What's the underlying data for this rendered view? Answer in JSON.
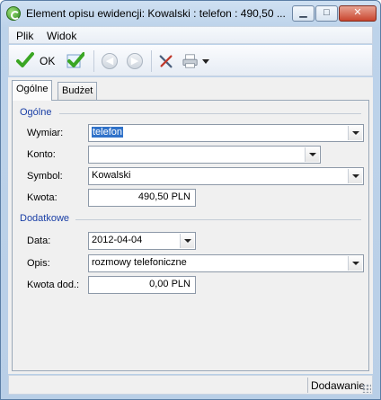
{
  "window": {
    "title": "Element opisu ewidencji: Kowalski : telefon : 490,50 ...",
    "min_symbol": "▁",
    "max_symbol": "□",
    "close_symbol": "✕"
  },
  "menu": [
    {
      "label": "Plik"
    },
    {
      "label": "Widok"
    }
  ],
  "toolbar": {
    "ok_label": "OK",
    "icons": [
      "save-check-icon",
      "save-check-plus-icon",
      "back-icon",
      "forward-icon",
      "tools-icon",
      "print-icon",
      "chevron-down-icon"
    ]
  },
  "tabs": [
    {
      "label": "Ogólne",
      "active": true
    },
    {
      "label": "Budżet",
      "active": false
    }
  ],
  "general": {
    "section_label": "Ogólne",
    "wymiar_label": "Wymiar:",
    "wymiar_value": "telefon",
    "konto_label": "Konto:",
    "konto_value": "",
    "symbol_label": "Symbol:",
    "symbol_value": "Kowalski",
    "kwota_label": "Kwota:",
    "kwota_value": "490,50 PLN"
  },
  "additional": {
    "section_label": "Dodatkowe",
    "data_label": "Data:",
    "data_value": "2012-04-04",
    "opis_label": "Opis:",
    "opis_value": "rozmowy telefoniczne",
    "kwota_dod_label": "Kwota dod.:",
    "kwota_dod_value": "0,00 PLN"
  },
  "status": {
    "text": "Dodawanie"
  },
  "colors": {
    "accent_blue": "#1a3fa6",
    "selection": "#3072c9",
    "check_green": "#3aa623"
  }
}
